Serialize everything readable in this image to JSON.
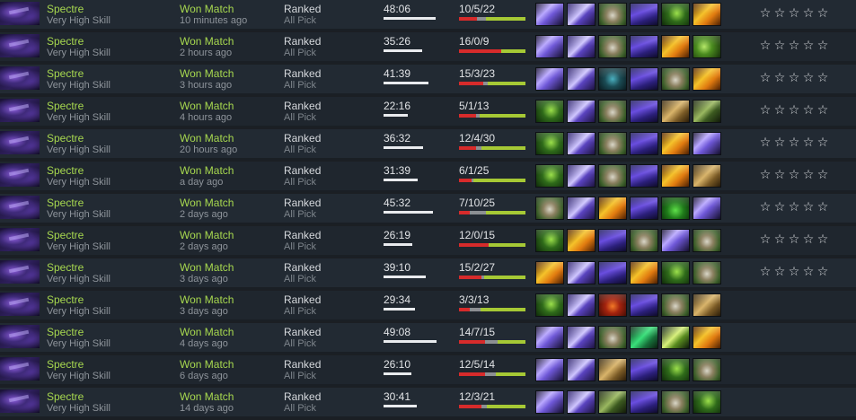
{
  "matches": [
    {
      "hero": "Spectre",
      "skill": "Very High Skill",
      "result": "Won Match",
      "ago": "10 minutes ago",
      "lobby": "Ranked",
      "mode": "All Pick",
      "duration": "48:06",
      "duration_minutes": 48.1,
      "kda": "10/5/22",
      "kills": 10,
      "deaths": 5,
      "assists": 22,
      "items": [
        "diffusal-icon",
        "yasha-icon",
        "drum-icon",
        "manta-icon",
        "butterfly-icon",
        "radiance-icon"
      ],
      "rating_stars": 5
    },
    {
      "hero": "Spectre",
      "skill": "Very High Skill",
      "result": "Won Match",
      "ago": "2 hours ago",
      "lobby": "Ranked",
      "mode": "All Pick",
      "duration": "35:26",
      "duration_minutes": 35.43,
      "kda": "16/0/9",
      "kills": 16,
      "deaths": 0,
      "assists": 9,
      "items": [
        "diffusal-icon",
        "yasha-icon",
        "drum-icon",
        "manta-icon",
        "radiance-icon",
        "phase-icon"
      ],
      "rating_stars": 5
    },
    {
      "hero": "Spectre",
      "skill": "Very High Skill",
      "result": "Won Match",
      "ago": "3 hours ago",
      "lobby": "Ranked",
      "mode": "All Pick",
      "duration": "41:39",
      "duration_minutes": 41.65,
      "kda": "15/3/23",
      "kills": 15,
      "deaths": 3,
      "assists": 23,
      "items": [
        "diffusal-icon",
        "yasha-icon",
        "skadi-icon",
        "manta-icon",
        "drum-icon",
        "radiance-icon"
      ],
      "rating_stars": 5
    },
    {
      "hero": "Spectre",
      "skill": "Very High Skill",
      "result": "Won Match",
      "ago": "4 hours ago",
      "lobby": "Ranked",
      "mode": "All Pick",
      "duration": "22:16",
      "duration_minutes": 22.27,
      "kda": "5/1/13",
      "kills": 5,
      "deaths": 1,
      "assists": 13,
      "items": [
        "butterfly-icon",
        "yasha-icon",
        "drum-icon",
        "manta-icon",
        "scroll-icon",
        "abyssal-icon"
      ],
      "rating_stars": 5
    },
    {
      "hero": "Spectre",
      "skill": "Very High Skill",
      "result": "Won Match",
      "ago": "20 hours ago",
      "lobby": "Ranked",
      "mode": "All Pick",
      "duration": "36:32",
      "duration_minutes": 36.53,
      "kda": "12/4/30",
      "kills": 12,
      "deaths": 4,
      "assists": 30,
      "items": [
        "butterfly-icon",
        "yasha-icon",
        "drum-icon",
        "manta-icon",
        "radiance-icon",
        "diffusal-icon"
      ],
      "rating_stars": 5
    },
    {
      "hero": "Spectre",
      "skill": "Very High Skill",
      "result": "Won Match",
      "ago": "a day ago",
      "lobby": "Ranked",
      "mode": "All Pick",
      "duration": "31:39",
      "duration_minutes": 31.65,
      "kda": "6/1/25",
      "kills": 6,
      "deaths": 1,
      "assists": 25,
      "items": [
        "butterfly-icon",
        "yasha-icon",
        "drum-icon",
        "manta-icon",
        "radiance-icon",
        "scroll-icon"
      ],
      "rating_stars": 5
    },
    {
      "hero": "Spectre",
      "skill": "Very High Skill",
      "result": "Won Match",
      "ago": "2 days ago",
      "lobby": "Ranked",
      "mode": "All Pick",
      "duration": "45:32",
      "duration_minutes": 45.53,
      "kda": "7/10/25",
      "kills": 7,
      "deaths": 10,
      "assists": 25,
      "items": [
        "drum-icon",
        "yasha-icon",
        "radiance-icon",
        "manta-icon",
        "bottle-icon",
        "diffusal-icon"
      ],
      "rating_stars": 5
    },
    {
      "hero": "Spectre",
      "skill": "Very High Skill",
      "result": "Won Match",
      "ago": "2 days ago",
      "lobby": "Ranked",
      "mode": "All Pick",
      "duration": "26:19",
      "duration_minutes": 26.32,
      "kda": "12/0/15",
      "kills": 12,
      "deaths": 0,
      "assists": 15,
      "items": [
        "butterfly-icon",
        "radiance-icon",
        "manta-icon",
        "drum-icon",
        "diffusal-icon",
        "drum-icon"
      ],
      "rating_stars": 5
    },
    {
      "hero": "Spectre",
      "skill": "Very High Skill",
      "result": "Won Match",
      "ago": "3 days ago",
      "lobby": "Ranked",
      "mode": "All Pick",
      "duration": "39:10",
      "duration_minutes": 39.17,
      "kda": "15/2/27",
      "kills": 15,
      "deaths": 2,
      "assists": 27,
      "items": [
        "radiance-icon",
        "yasha-icon",
        "manta-icon",
        "radiance-icon",
        "butterfly-icon",
        "drum-icon"
      ],
      "rating_stars": 5
    },
    {
      "hero": "Spectre",
      "skill": "Very High Skill",
      "result": "Won Match",
      "ago": "3 days ago",
      "lobby": "Ranked",
      "mode": "All Pick",
      "duration": "29:34",
      "duration_minutes": 29.57,
      "kda": "3/3/13",
      "kills": 3,
      "deaths": 3,
      "assists": 13,
      "items": [
        "butterfly-icon",
        "yasha-icon",
        "heart-icon",
        "manta-icon",
        "drum-icon",
        "scroll-icon"
      ],
      "rating_stars": 0
    },
    {
      "hero": "Spectre",
      "skill": "Very High Skill",
      "result": "Won Match",
      "ago": "4 days ago",
      "lobby": "Ranked",
      "mode": "All Pick",
      "duration": "49:08",
      "duration_minutes": 49.13,
      "kda": "14/7/15",
      "kills": 14,
      "deaths": 7,
      "assists": 15,
      "items": [
        "diffusal-icon",
        "yasha-icon",
        "drum-icon",
        "greaves-icon",
        "pike-icon",
        "radiance-icon"
      ],
      "rating_stars": 0
    },
    {
      "hero": "Spectre",
      "skill": "Very High Skill",
      "result": "Won Match",
      "ago": "6 days ago",
      "lobby": "Ranked",
      "mode": "All Pick",
      "duration": "26:10",
      "duration_minutes": 26.17,
      "kda": "12/5/14",
      "kills": 12,
      "deaths": 5,
      "assists": 14,
      "items": [
        "diffusal-icon",
        "yasha-icon",
        "scroll-icon",
        "manta-icon",
        "butterfly-icon",
        "drum-icon"
      ],
      "rating_stars": 0
    },
    {
      "hero": "Spectre",
      "skill": "Very High Skill",
      "result": "Won Match",
      "ago": "14 days ago",
      "lobby": "Ranked",
      "mode": "All Pick",
      "duration": "30:41",
      "duration_minutes": 30.68,
      "kda": "12/3/21",
      "kills": 12,
      "deaths": 3,
      "assists": 21,
      "items": [
        "diffusal-icon",
        "yasha-icon",
        "abyssal-icon",
        "manta-icon",
        "drum-icon",
        "butterfly-icon"
      ],
      "rating_stars": 0
    }
  ],
  "colors": {
    "win_text": "#a7d84f",
    "muted_text": "#8e949b",
    "kills_bar": "#d72b2b",
    "deaths_bar": "#8c8f93",
    "assists_bar": "#a6c935",
    "star": "#d8dadd"
  },
  "icons": {
    "star": "☆"
  }
}
